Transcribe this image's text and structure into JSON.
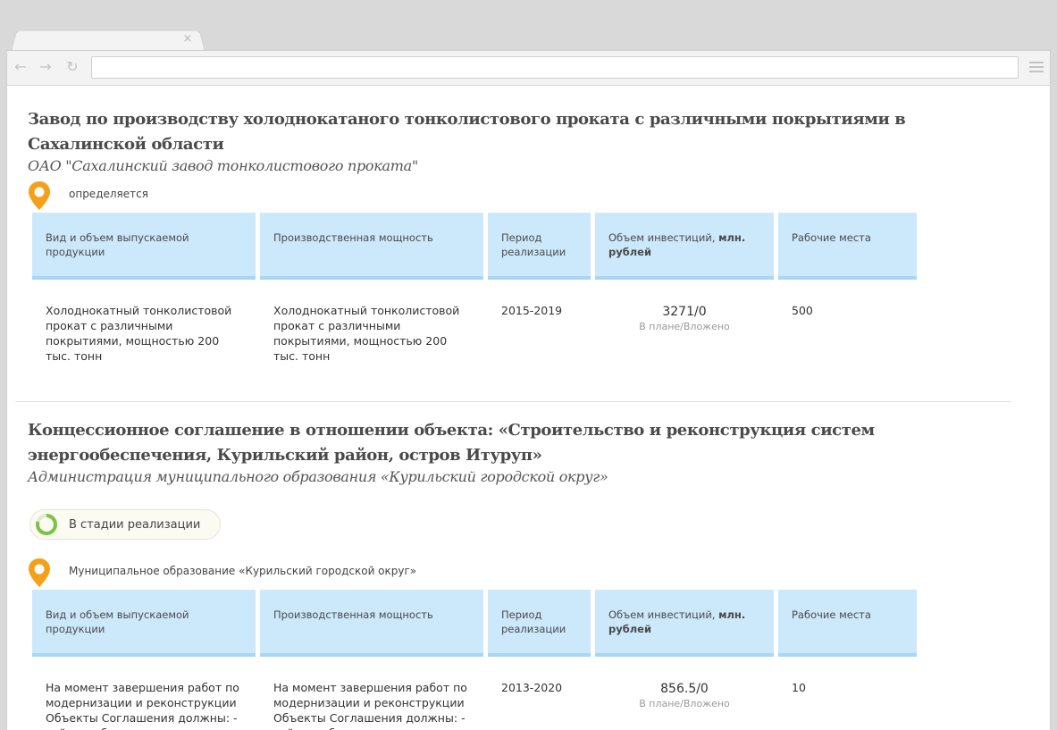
{
  "browser": {
    "tab_close": "×",
    "back": "←",
    "forward": "→",
    "reload": "↻"
  },
  "table_headers": {
    "product": "Вид и объем выпускаемой продукции",
    "capacity": "Производственная мощность",
    "period": "Период реализации",
    "investment_prefix": "Объем инвестиций, ",
    "investment_unit": "млн. рублей",
    "jobs": "Рабочие места"
  },
  "projects": [
    {
      "title": "Завод по производству холоднокатаного тонколистового проката с различными покрытиями в Сахалинской области",
      "org": "ОАО \"Сахалинский завод тонколистового проката\"",
      "location": "определяется",
      "row": {
        "product": "Холоднокатный тонколистовой прокат с различными покрытиями, мощностью 200 тыс. тонн",
        "capacity": "Холоднокатный тонколистовой прокат с различными покрытиями, мощностью 200 тыс. тонн",
        "period": "2015-2019",
        "investment": "3271/0",
        "investment_sub": "В плане/Вложено",
        "jobs": "500"
      }
    },
    {
      "title": "Концессионное соглашение в отношении объекта: «Строительство и реконструкция систем энергообеспечения, Курильский район, остров Итуруп»",
      "org": "Администрация муниципального образования «Курильский городской округ»",
      "status": "В стадии реализации",
      "location": "Муниципальное образование «Курильский городской округ»",
      "row": {
        "product": "На момент завершения работ по модернизации и реконструкции Объекты Соглашения должны: - войти в общую оптико-",
        "capacity": "На момент завершения работ по модернизации и реконструкции Объекты Соглашения должны: - войти в общую оптико-",
        "period": "2013-2020",
        "investment": "856.5/0",
        "investment_sub": "В плане/Вложено",
        "jobs": "10"
      }
    }
  ],
  "colors": {
    "pin": "#f5a01a",
    "header_bg": "#cce8fb",
    "header_border": "#a9d6f4",
    "status_ring": "#7cc243"
  }
}
